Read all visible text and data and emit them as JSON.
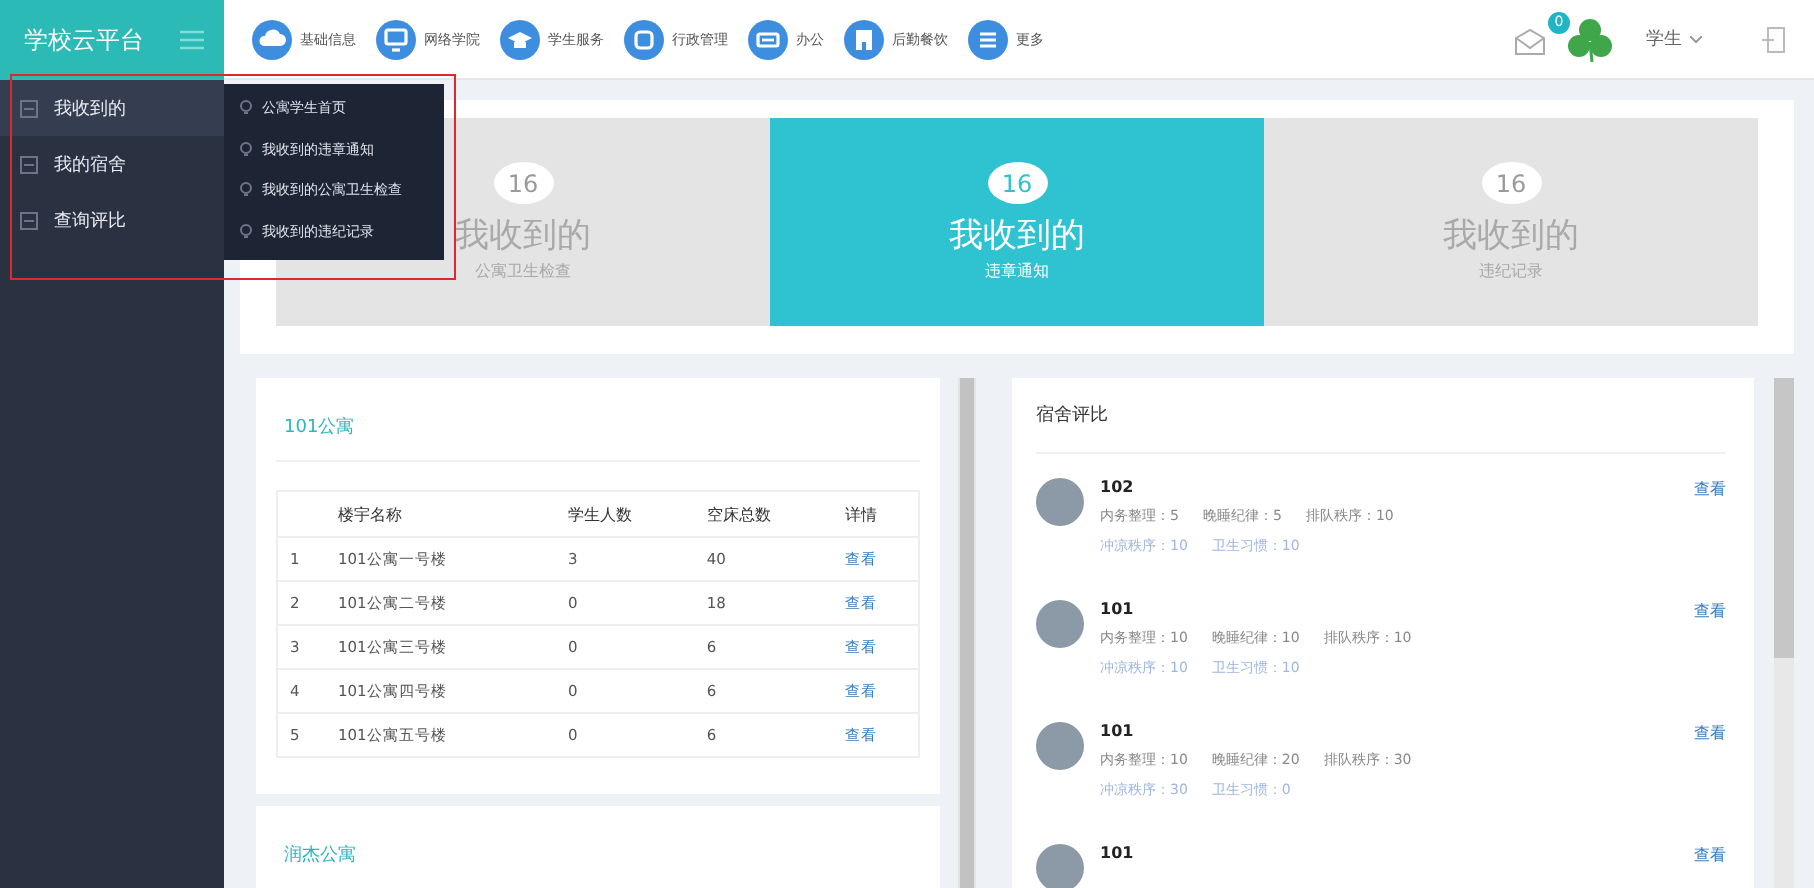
{
  "sidebar": {
    "title": "学校云平台",
    "items": [
      {
        "label": "我收到的",
        "selected": true
      },
      {
        "label": "我的宿舍",
        "selected": false
      },
      {
        "label": "查询评比",
        "selected": false
      }
    ]
  },
  "flyout": {
    "items": [
      "公寓学生首页",
      "我收到的违章通知",
      "我收到的公寓卫生检查",
      "我收到的违纪记录"
    ]
  },
  "top_nav": [
    "基础信息",
    "网络学院",
    "学生服务",
    "行政管理",
    "办公",
    "后勤餐饮",
    "更多"
  ],
  "header": {
    "message_count": "0",
    "user": "学生"
  },
  "stat_tiles": [
    {
      "count": "16",
      "title": "我收到的",
      "subtitle": "公寓卫生检查",
      "selected": false
    },
    {
      "count": "16",
      "title": "我收到的",
      "subtitle": "违章通知",
      "selected": true
    },
    {
      "count": "16",
      "title": "我收到的",
      "subtitle": "违纪记录",
      "selected": false
    }
  ],
  "apartments": [
    {
      "title": "101公寓",
      "table": {
        "columns": [
          "",
          "楼宇名称",
          "学生人数",
          "空床总数",
          "详情"
        ],
        "rows": [
          [
            "1",
            "101公寓一号楼",
            "3",
            "40",
            "查看"
          ],
          [
            "2",
            "101公寓二号楼",
            "0",
            "18",
            "查看"
          ],
          [
            "3",
            "101公寓三号楼",
            "0",
            "6",
            "查看"
          ],
          [
            "4",
            "101公寓四号楼",
            "0",
            "6",
            "查看"
          ],
          [
            "5",
            "101公寓五号楼",
            "0",
            "6",
            "查看"
          ]
        ]
      }
    },
    {
      "title": "润杰公寓"
    }
  ],
  "dorm_ratings": {
    "title": "宿舍评比",
    "items": [
      {
        "name": "102",
        "action": "查看",
        "scores": [
          "内务整理：5",
          "晚睡纪律：5",
          "排队秩序：10"
        ],
        "extra_scores": [
          "冲凉秩序：10",
          "卫生习惯：10"
        ]
      },
      {
        "name": "101",
        "action": "查看",
        "scores": [
          "内务整理：10",
          "晚睡纪律：10",
          "排队秩序：10"
        ],
        "extra_scores": [
          "冲凉秩序：10",
          "卫生习惯：10"
        ]
      },
      {
        "name": "101",
        "action": "查看",
        "scores": [
          "内务整理：10",
          "晚睡纪律：20",
          "排队秩序：30"
        ],
        "extra_scores": [
          "冲凉秩序：30",
          "卫生习惯：0"
        ]
      },
      {
        "name": "101",
        "action": "查看"
      }
    ]
  }
}
